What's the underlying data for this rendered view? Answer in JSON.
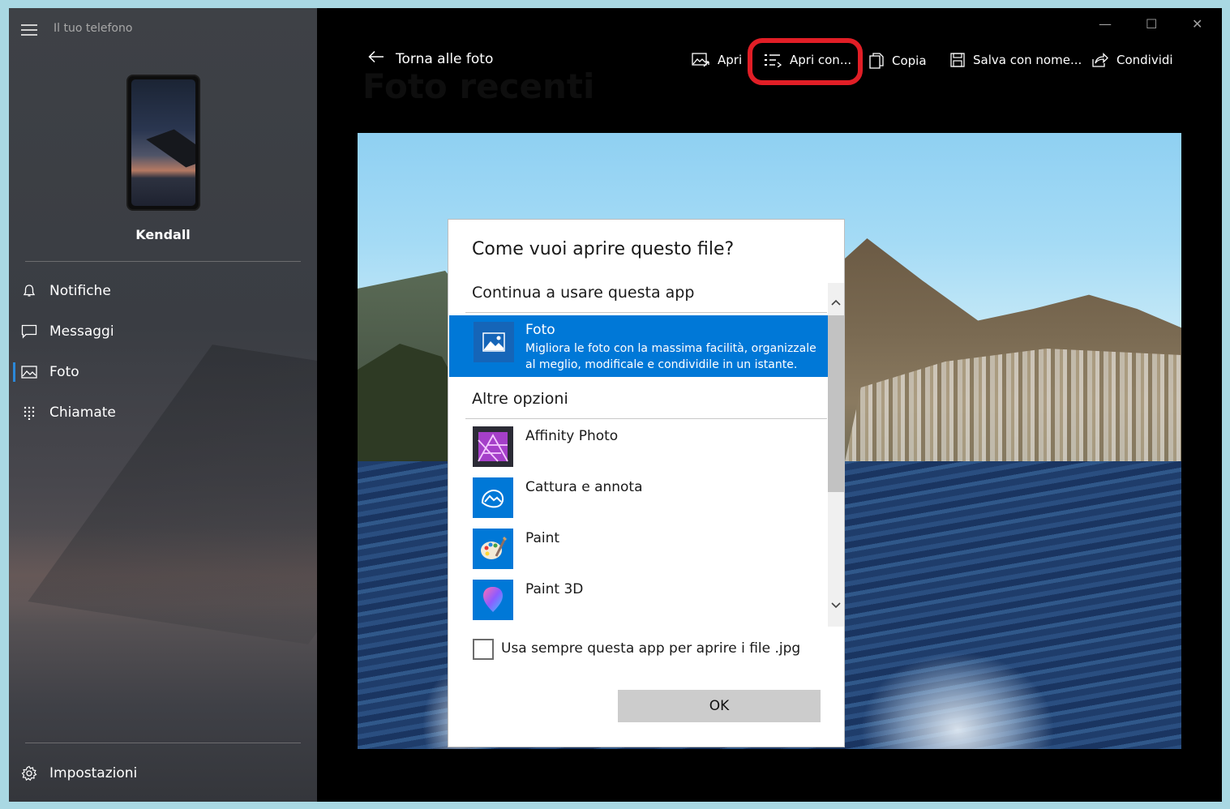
{
  "sidebar": {
    "app_title": "Il tuo telefono",
    "device_name": "Kendall",
    "nav": [
      {
        "label": "Notifiche",
        "icon": "bell-icon"
      },
      {
        "label": "Messaggi",
        "icon": "chat-icon"
      },
      {
        "label": "Foto",
        "icon": "photo-icon",
        "active": true
      },
      {
        "label": "Chiamate",
        "icon": "dialpad-icon"
      }
    ],
    "settings_label": "Impostazioni"
  },
  "window_controls": {
    "minimize": "—",
    "maximize": "☐",
    "close": "✕"
  },
  "header": {
    "back_label": "Torna alle foto",
    "ghost_title": "Foto recenti"
  },
  "toolbar": {
    "open": "Apri",
    "open_with": "Apri con...",
    "copy": "Copia",
    "save_as": "Salva con nome...",
    "share": "Condividi",
    "highlight_color": "#e11e26"
  },
  "dialog": {
    "title": "Come vuoi aprire questo file?",
    "keep_using": "Continua a usare questa app",
    "selected_app": {
      "name": "Foto",
      "description": "Migliora le foto con la massima facilità, organizzale al meglio, modificale e condividile in un istante."
    },
    "other_options": "Altre opzioni",
    "apps": [
      {
        "name": "Affinity Photo",
        "icon": "affinity-photo-icon"
      },
      {
        "name": "Cattura e annota",
        "icon": "snip-sketch-icon"
      },
      {
        "name": "Paint",
        "icon": "paint-icon"
      },
      {
        "name": "Paint 3D",
        "icon": "paint3d-icon"
      }
    ],
    "always_use_label": "Usa sempre questa app per aprire i file .jpg",
    "always_use_checked": false,
    "ok_label": "OK",
    "accent": "#0078d7"
  }
}
